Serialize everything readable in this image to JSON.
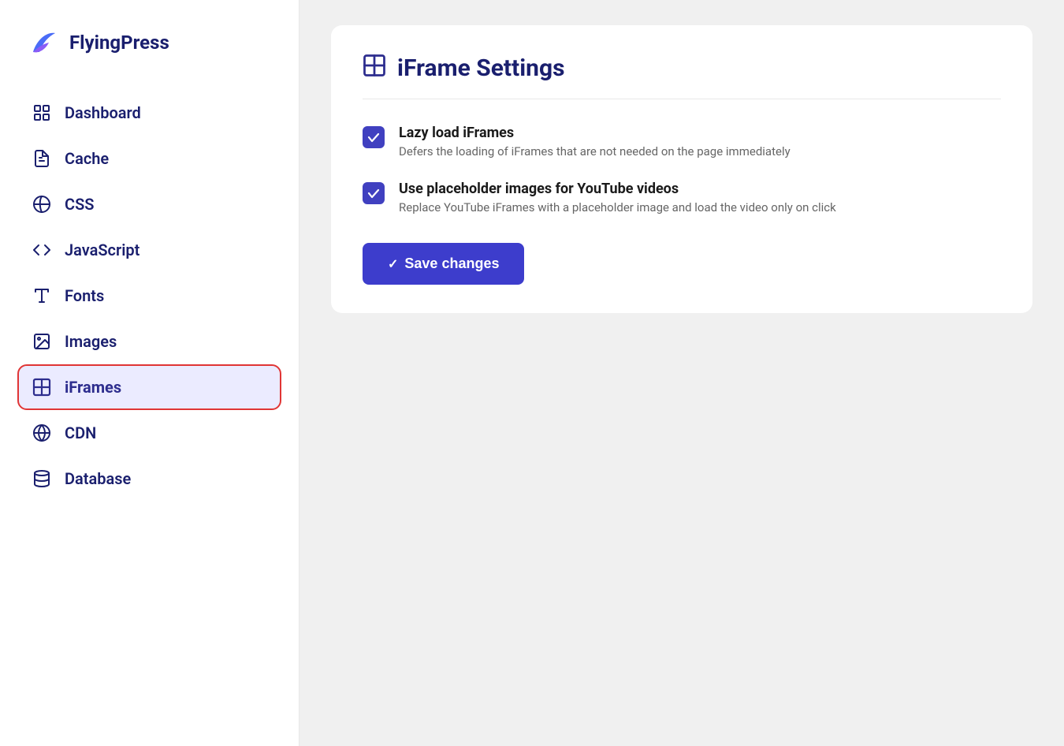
{
  "brand": {
    "name": "FlyingPress"
  },
  "sidebar": {
    "items": [
      {
        "id": "dashboard",
        "label": "Dashboard",
        "icon": "dashboard-icon"
      },
      {
        "id": "cache",
        "label": "Cache",
        "icon": "cache-icon"
      },
      {
        "id": "css",
        "label": "CSS",
        "icon": "css-icon"
      },
      {
        "id": "javascript",
        "label": "JavaScript",
        "icon": "javascript-icon"
      },
      {
        "id": "fonts",
        "label": "Fonts",
        "icon": "fonts-icon"
      },
      {
        "id": "images",
        "label": "Images",
        "icon": "images-icon"
      },
      {
        "id": "iframes",
        "label": "iFrames",
        "icon": "iframes-icon",
        "active": true
      },
      {
        "id": "cdn",
        "label": "CDN",
        "icon": "cdn-icon"
      },
      {
        "id": "database",
        "label": "Database",
        "icon": "database-icon"
      }
    ]
  },
  "main": {
    "page_title": "iFrame Settings",
    "settings": [
      {
        "id": "lazy-load",
        "title": "Lazy load iFrames",
        "description": "Defers the loading of iFrames that are not needed on the page immediately",
        "checked": true
      },
      {
        "id": "placeholder-images",
        "title": "Use placeholder images for YouTube videos",
        "description": "Replace YouTube iFrames with a placeholder image and load the video only on click",
        "checked": true
      }
    ],
    "save_button_label": "Save changes"
  },
  "colors": {
    "accent": "#3d3dcc",
    "brand_dark": "#1a1f6e",
    "active_bg": "#ebebff",
    "active_border": "#e03535"
  }
}
